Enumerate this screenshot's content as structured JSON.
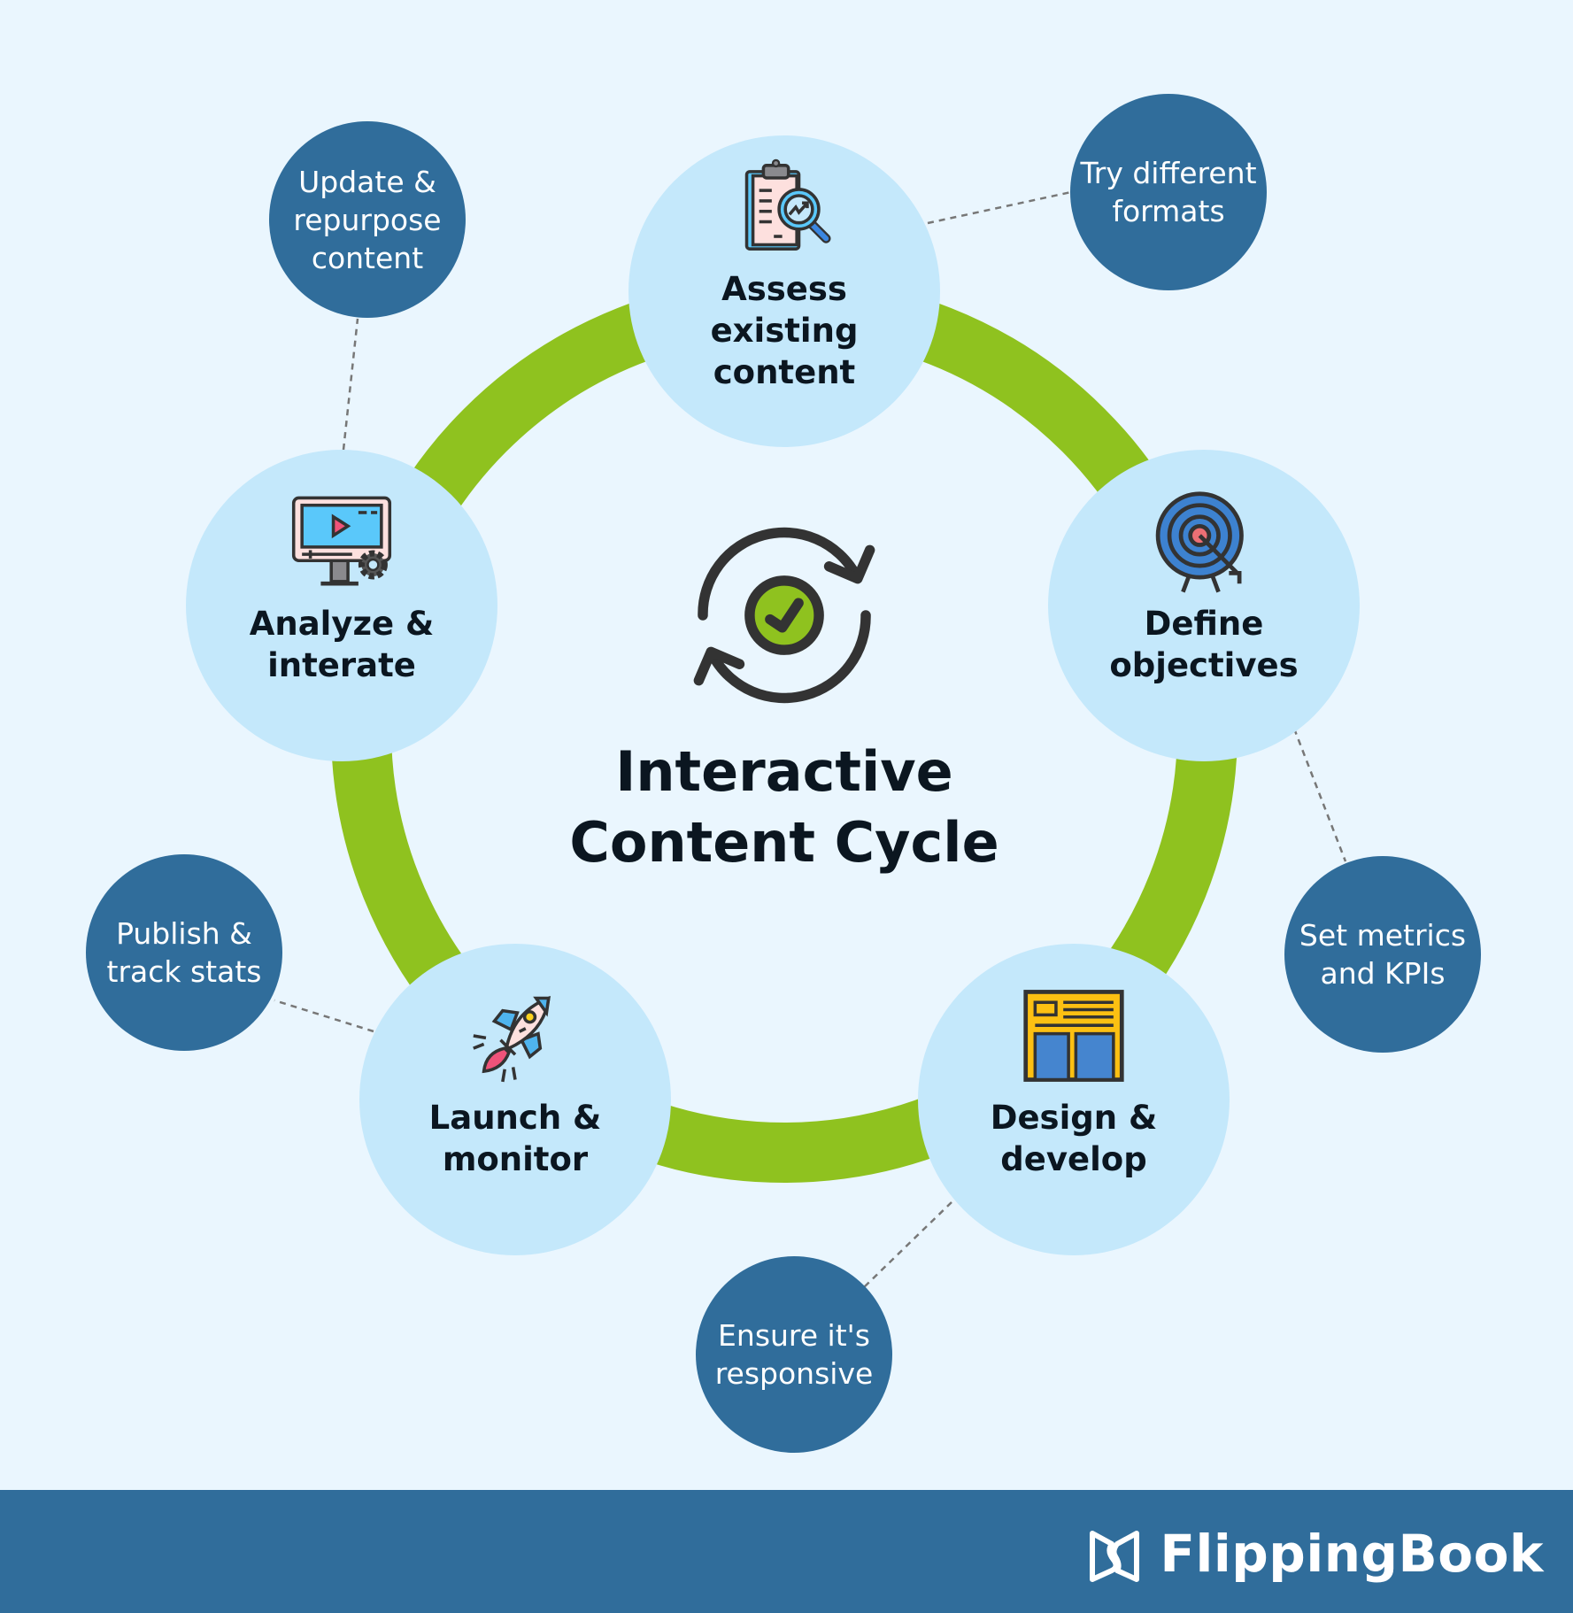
{
  "title": "Interactive\nContent Cycle",
  "colors": {
    "background": "#eaf6fe",
    "ring": "#8fc21f",
    "stage_fill": "#c4e8fb",
    "tip_fill": "#306d9b",
    "connector": "#777777",
    "text_dark": "#0b1620",
    "text_light": "#ffffff",
    "footer": "#306d9b"
  },
  "stages": [
    {
      "id": "assess",
      "label": "Assess existing\ncontent",
      "icon": "clipboard-magnifier-icon"
    },
    {
      "id": "define",
      "label": "Define\nobjectives",
      "icon": "target-icon"
    },
    {
      "id": "design",
      "label": "Design &\ndevelop",
      "icon": "layout-wireframe-icon"
    },
    {
      "id": "launch",
      "label": "Launch &\nmonitor",
      "icon": "rocket-icon"
    },
    {
      "id": "analyze",
      "label": "Analyze &\ninterate",
      "icon": "monitor-gear-icon"
    }
  ],
  "tips": [
    {
      "id": "try",
      "label": "Try different\nformats",
      "attached_to": "assess"
    },
    {
      "id": "metrics",
      "label": "Set metrics\nand KPIs",
      "attached_to": "define"
    },
    {
      "id": "responsive",
      "label": "Ensure it's\nresponsive",
      "attached_to": "design"
    },
    {
      "id": "publish",
      "label": "Publish &\ntrack stats",
      "attached_to": "launch"
    },
    {
      "id": "update",
      "label": "Update &\nrepurpose\ncontent",
      "attached_to": "analyze"
    }
  ],
  "center_icon": "cycle-check-icon",
  "footer": {
    "brand": "FlippingBook",
    "logo_icon": "flippingbook-logo-icon"
  }
}
